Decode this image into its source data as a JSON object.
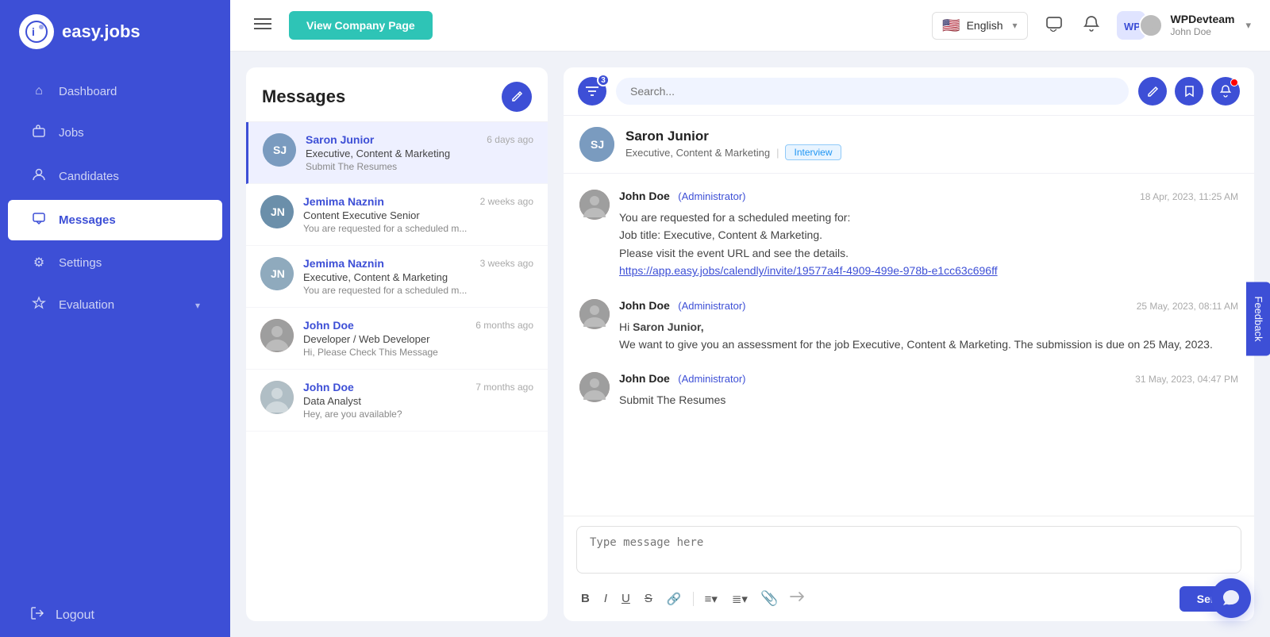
{
  "sidebar": {
    "logo_text": "easy.jobs",
    "logo_icon": "i",
    "items": [
      {
        "key": "dashboard",
        "label": "Dashboard",
        "icon": "⌂",
        "active": false
      },
      {
        "key": "jobs",
        "label": "Jobs",
        "icon": "💼",
        "active": false
      },
      {
        "key": "candidates",
        "label": "Candidates",
        "icon": "👤",
        "active": false
      },
      {
        "key": "messages",
        "label": "Messages",
        "icon": "✉",
        "active": true
      },
      {
        "key": "settings",
        "label": "Settings",
        "icon": "⚙",
        "active": false
      },
      {
        "key": "evaluation",
        "label": "Evaluation",
        "icon": "🎓",
        "active": false,
        "has_sub": true
      }
    ],
    "logout_label": "Logout",
    "logout_icon": "→"
  },
  "header": {
    "view_company_label": "View Company Page",
    "lang_label": "English",
    "lang_flag": "🇺🇸",
    "user_name": "WPDevteam",
    "user_sub": "John Doe"
  },
  "messages_panel": {
    "title": "Messages",
    "compose_icon": "✏",
    "items": [
      {
        "name": "Saron Junior",
        "role": "Executive, Content & Marketing",
        "preview": "Submit The Resumes",
        "time": "6 days ago",
        "avatar_type": "landscape",
        "active": true
      },
      {
        "name": "Jemima Naznin",
        "role": "Content Executive Senior",
        "preview": "You are requested for a scheduled m...",
        "time": "2 weeks ago",
        "avatar_type": "landscape2",
        "active": false
      },
      {
        "name": "Jemima Naznin",
        "role": "Executive, Content & Marketing",
        "preview": "You are requested for a scheduled m...",
        "time": "3 weeks ago",
        "avatar_type": "landscape2",
        "active": false
      },
      {
        "name": "John Doe",
        "role": "Developer / Web Developer",
        "preview": "Hi, Please Check This Message",
        "time": "6 months ago",
        "avatar_type": "person",
        "active": false
      },
      {
        "name": "John Doe",
        "role": "Data Analyst",
        "preview": "Hey, are you available?",
        "time": "7 months ago",
        "avatar_type": "person2",
        "active": false
      }
    ]
  },
  "chat": {
    "filter_badge": "3",
    "search_placeholder": "Search...",
    "contact_name": "Saron Junior",
    "contact_role": "Executive, Content & Marketing",
    "contact_badge": "Interview",
    "messages": [
      {
        "sender": "John Doe",
        "role_label": "(Administrator)",
        "time": "18 Apr, 2023, 11:25 AM",
        "lines": [
          "You are requested for a scheduled meeting for:",
          "Job title: Executive, Content & Marketing.",
          "Please visit the event URL and see the details.",
          "https://app.easy.jobs/calendly/invite/19577a4f-4909-499e-978b-e1cc63c696ff"
        ]
      },
      {
        "sender": "John Doe",
        "role_label": "(Administrator)",
        "time": "25 May, 2023, 08:11 AM",
        "lines": [
          "Hi Saron Junior,",
          "We want to give you an assessment for the job Executive, Content & Marketing. The submission is due on 25 May, 2023."
        ]
      },
      {
        "sender": "John Doe",
        "role_label": "(Administrator)",
        "time": "31 May, 2023, 04:47 PM",
        "lines": [
          "Submit The Resumes"
        ]
      }
    ],
    "input_placeholder": "Type message here",
    "send_label": "Send",
    "toolbar_buttons": [
      "B",
      "I",
      "U",
      "S",
      "🔗",
      "≡",
      "≣"
    ]
  },
  "feedback_label": "Feedback"
}
